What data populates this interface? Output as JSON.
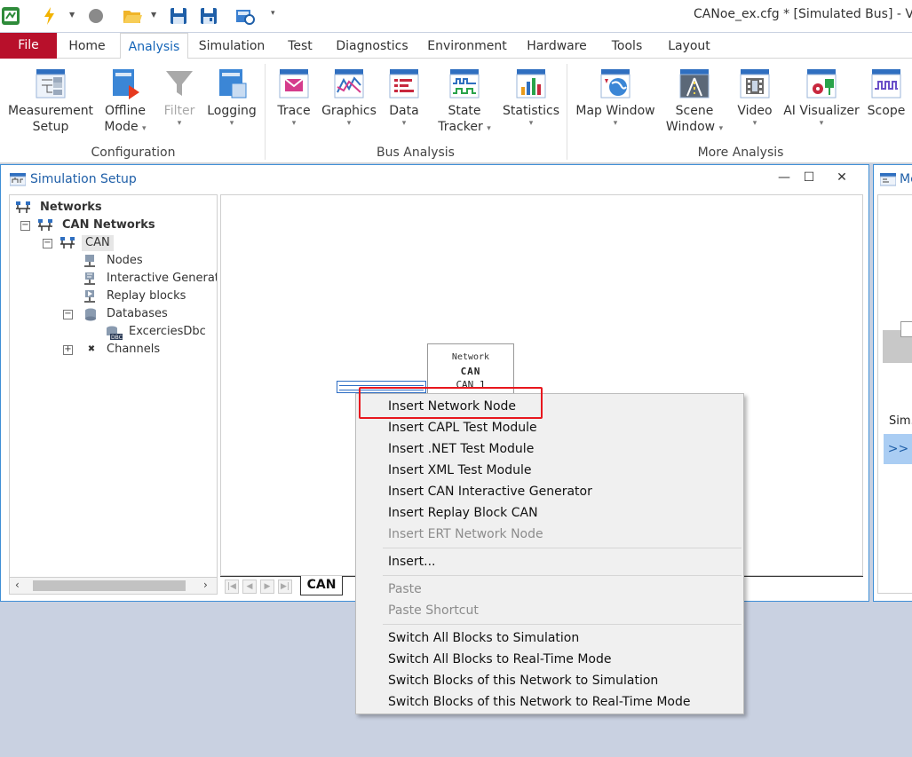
{
  "titlebar": {
    "title": "CANoe_ex.cfg * [Simulated Bus] - Ve",
    "quick_access": [
      "app-logo-icon",
      "lightning-icon",
      "stop-icon",
      "open-folder-icon",
      "save-icon",
      "save-as-icon",
      "configuration-icon"
    ]
  },
  "ribbon": {
    "file_label": "File",
    "tabs": [
      "Home",
      "Analysis",
      "Simulation",
      "Test",
      "Diagnostics",
      "Environment",
      "Hardware",
      "Tools",
      "Layout"
    ],
    "active_tab": "Analysis",
    "buttons": {
      "measurement_setup": [
        "Measurement",
        "Setup"
      ],
      "offline_mode": [
        "Offline",
        "Mode"
      ],
      "filter": "Filter",
      "logging": "Logging",
      "trace": "Trace",
      "graphics": "Graphics",
      "data": "Data",
      "state_tracker": [
        "State",
        "Tracker"
      ],
      "statistics": "Statistics",
      "map_window": "Map Window",
      "scene_window": [
        "Scene",
        "Window"
      ],
      "video": "Video",
      "ai_visualizer": "AI Visualizer",
      "scope": "Scope"
    },
    "groups": {
      "configuration": "Configuration",
      "bus_analysis": "Bus Analysis",
      "more_analysis": "More Analysis"
    }
  },
  "simulation_setup": {
    "title": "Simulation Setup",
    "controls": {
      "minimize": "—",
      "maximize": "☐",
      "close": "✕"
    },
    "tree": {
      "networks": "Networks",
      "can_networks": "CAN Networks",
      "can": "CAN",
      "nodes": "Nodes",
      "interactive_generators": "Interactive Generat...",
      "replay_blocks": "Replay blocks",
      "databases": "Databases",
      "database_item": "ExcerciesDbc",
      "channels": "Channels"
    },
    "canvas": {
      "network_box": {
        "line1": "Network",
        "line2": "CAN",
        "line3": "CAN 1"
      }
    },
    "bottom_tab": "CAN"
  },
  "right_window": {
    "title": "Me",
    "sim_label": "Sim.",
    "expand_button": ">>"
  },
  "context_menu": {
    "items": [
      {
        "label": "Insert Network Node",
        "enabled": true
      },
      {
        "label": "Insert CAPL Test Module",
        "enabled": true
      },
      {
        "label": "Insert .NET Test Module",
        "enabled": true
      },
      {
        "label": "Insert XML Test Module",
        "enabled": true
      },
      {
        "label": "Insert CAN Interactive Generator",
        "enabled": true
      },
      {
        "label": "Insert Replay Block CAN",
        "enabled": true
      },
      {
        "label": "Insert ERT Network Node",
        "enabled": false
      },
      {
        "label": "Insert...",
        "enabled": true
      },
      {
        "label": "Paste",
        "enabled": false
      },
      {
        "label": "Paste Shortcut",
        "enabled": false
      },
      {
        "label": "Switch All Blocks to Simulation",
        "enabled": true
      },
      {
        "label": "Switch All Blocks to Real-Time Mode",
        "enabled": true
      },
      {
        "label": "Switch Blocks of this Network to Simulation",
        "enabled": true
      },
      {
        "label": "Switch Blocks of this Network to Real-Time Mode",
        "enabled": true
      }
    ],
    "highlighted_item": "Insert Network Node"
  },
  "colors": {
    "file_tab": "#b8102b",
    "accent_blue": "#1565b8",
    "highlight_red": "#e8171e",
    "workspace_bg": "#c9d1e1"
  }
}
